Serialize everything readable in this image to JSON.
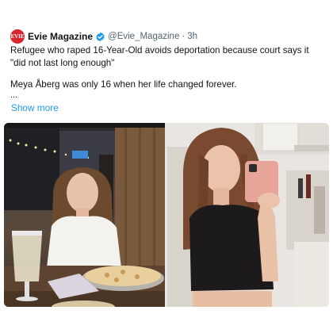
{
  "author": {
    "avatar_text": "EVIE",
    "name": "Evie Magazine",
    "handle": "@Evie_Magazine",
    "separator": "·",
    "time": "3h",
    "verified": true
  },
  "tweet": {
    "headline": "Refugee who raped 16-Year-Old avoids deportation because court says it \"did not last long enough\"",
    "paragraph": "Meya Åberg was only 16 when her life changed forever.",
    "ellipsis": "...",
    "show_more": "Show more"
  },
  "media": {
    "images": [
      {
        "description_icon": "restaurant-photo"
      },
      {
        "description_icon": "mirror-selfie-photo"
      }
    ]
  },
  "colors": {
    "link": "#1d9bf0",
    "verified": "#1d9bf0",
    "avatar_bg": "#d8262d",
    "meta_text": "#536471"
  }
}
